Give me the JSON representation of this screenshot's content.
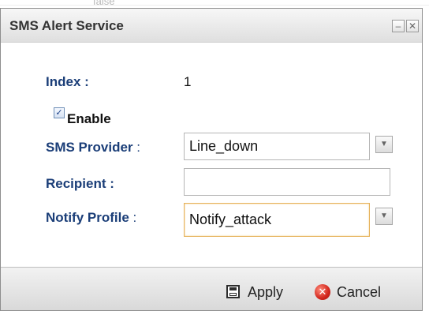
{
  "background": {
    "top_text": "false"
  },
  "dialog": {
    "title": "SMS Alert Service",
    "controls": {
      "minimize": "–",
      "close": "✕"
    }
  },
  "form": {
    "index_label": "Index :",
    "index_value": "1",
    "enable_label": "Enable",
    "enable_checked": true,
    "sms_provider_label": "SMS Provider",
    "sms_provider_colon": ":",
    "sms_provider_value": "Line_down",
    "recipient_label": "Recipient :",
    "recipient_value": "",
    "notify_profile_label": "Notify Profile",
    "notify_profile_colon": ":",
    "notify_profile_value": "Notify_attack"
  },
  "footer": {
    "apply_label": "Apply",
    "cancel_label": "Cancel"
  },
  "icons": {
    "checkbox": "check-icon",
    "apply": "save-icon",
    "cancel": "cancel-icon",
    "dropdown": "chevron-down-icon"
  },
  "colors": {
    "label": "#1b3e78",
    "focus_border": "#e6b25a",
    "cancel_red": "#d2261c"
  }
}
